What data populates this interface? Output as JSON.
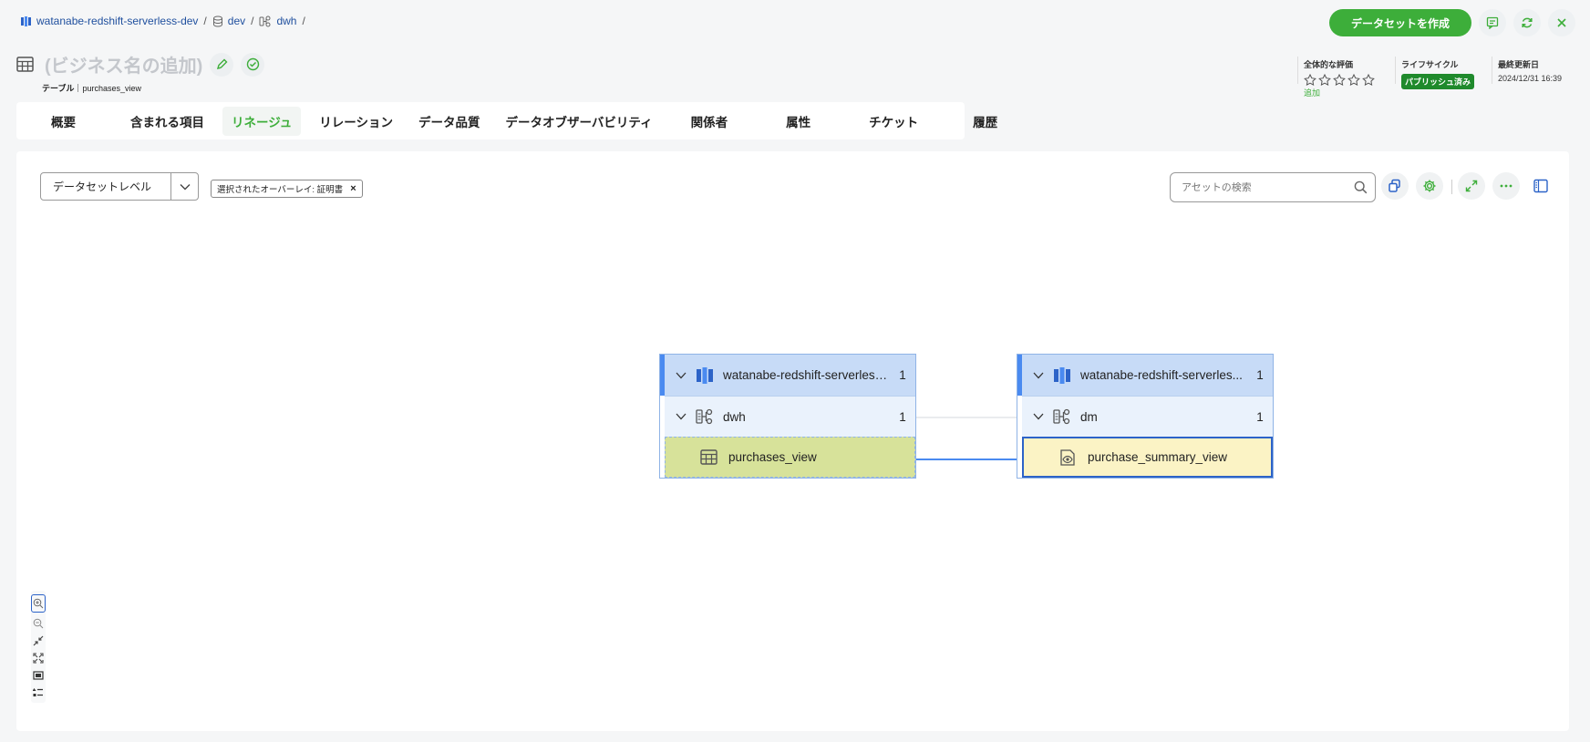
{
  "breadcrumb": [
    {
      "label": "watanabe-redshift-serverless-dev",
      "icon": "redshift-icon"
    },
    {
      "label": "dev",
      "icon": "database-icon"
    },
    {
      "label": "dwh",
      "icon": "schema-icon"
    }
  ],
  "actions": {
    "create_dataset": "データセットを作成"
  },
  "header": {
    "title": "(ビジネス名の追加)",
    "type": "テーブル",
    "name": "purchases_view",
    "rating_label": "全体的な評価",
    "rating_value": 0,
    "rating_max": 5,
    "rating_add": "追加",
    "lifecycle_label": "ライフサイクル",
    "lifecycle_value": "パブリッシュ済み",
    "updated_label": "最終更新日",
    "updated_value": "2024/12/31 16:39"
  },
  "tabs": [
    {
      "label": "概要",
      "active": false
    },
    {
      "label": "含まれる項目",
      "active": false
    },
    {
      "label": "リネージュ",
      "active": true
    },
    {
      "label": "リレーション",
      "active": false
    },
    {
      "label": "データ品質",
      "active": false
    },
    {
      "label": "データオブザーバビリティ",
      "active": false
    },
    {
      "label": "関係者",
      "active": false
    },
    {
      "label": "属性",
      "active": false
    },
    {
      "label": "チケット",
      "active": false
    },
    {
      "label": "履歴",
      "active": false
    }
  ],
  "lineage": {
    "level_select": "データセットレベル",
    "overlay_chip": "選択されたオーバーレイ: 証明書",
    "search_placeholder": "アセットの検索",
    "nodes": [
      {
        "source": "watanabe-redshift-serverless-dev",
        "source_display": "watanabe-redshift-serverless...",
        "source_count": "1",
        "schema": "dwh",
        "schema_count": "1",
        "asset": "purchases_view",
        "asset_type": "table-icon"
      },
      {
        "source": "watanabe-redshift-serverless-dev",
        "source_display": "watanabe-redshift-serverles...",
        "source_count": "1",
        "schema": "dm",
        "schema_count": "1",
        "asset": "purchase_summary_view",
        "asset_type": "view-icon"
      }
    ]
  },
  "colors": {
    "accent": "#3dae3a",
    "link": "#1f4f9e",
    "node_header": "#c7dbf7",
    "table_highlight": "#d7e29a",
    "view_highlight": "#fbf3c5",
    "edge": "#4a8af0"
  }
}
